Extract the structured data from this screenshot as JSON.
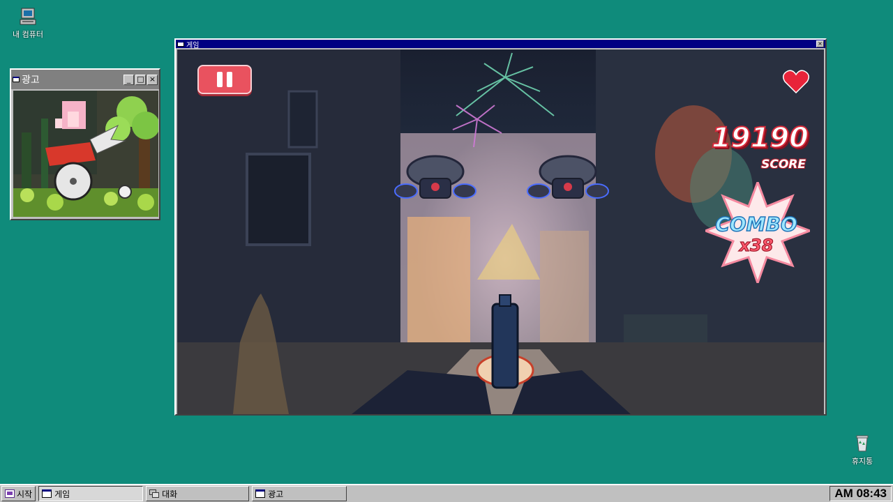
{
  "desktop": {
    "my_computer_label": "내 컴퓨터",
    "trash_label": "휴지통",
    "background_color": "#0f8b7b"
  },
  "game_window": {
    "title": "게임",
    "titlebar_color": "#000082",
    "hud": {
      "score_value": "19190",
      "score_label": "SCORE",
      "combo_label": "COMBO",
      "combo_count": "x38",
      "lives_icon": "heart-icon",
      "pause_icon": "pause-icon"
    }
  },
  "ad_window": {
    "title": "광고",
    "titlebar_color": "#808080"
  },
  "taskbar": {
    "start_label": "시작",
    "items": [
      {
        "label": "게임",
        "active": true
      },
      {
        "label": "대화",
        "active": false
      },
      {
        "label": "광고",
        "active": false
      }
    ],
    "clock": "AM 08:43"
  }
}
